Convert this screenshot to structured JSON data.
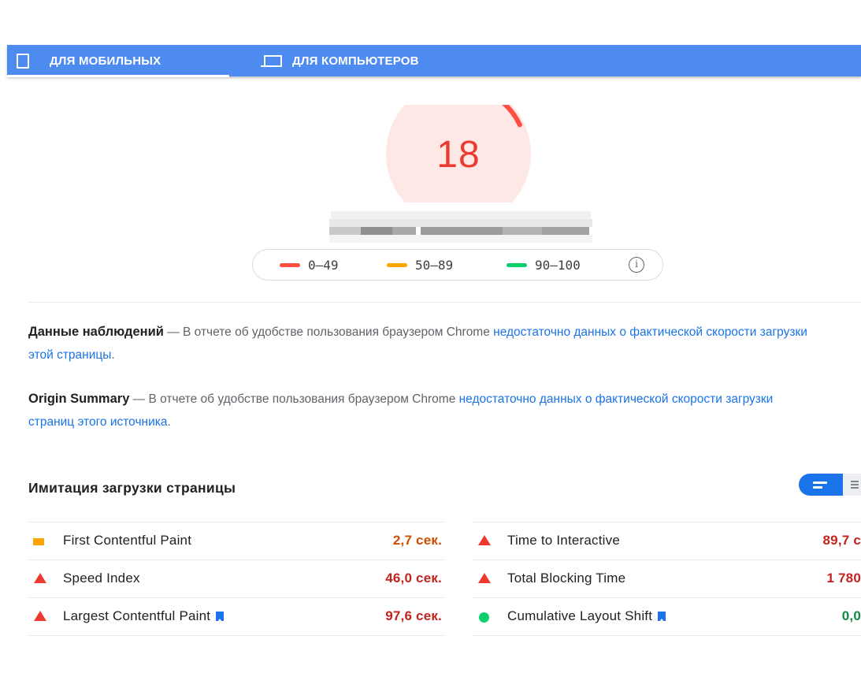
{
  "tabs": {
    "mobile_label": "ДЛЯ МОБИЛЬНЫХ",
    "desktop_label": "ДЛЯ КОМПЬЮТЕРОВ",
    "active": "mobile"
  },
  "score": {
    "value": "18",
    "fraction": 0.18,
    "color": "#eb3b30"
  },
  "legend": {
    "ranges": [
      {
        "label": "0–49",
        "color": "#ff4e42"
      },
      {
        "label": "50–89",
        "color": "#ffa400"
      },
      {
        "label": "90–100",
        "color": "#0cce6b"
      }
    ],
    "info_icon": "info-icon"
  },
  "field_data": {
    "heading": "Данные наблюдений",
    "text": " — В отчете об удобстве пользования браузером Chrome ",
    "link": "недостаточно данных о фактической скорости загрузки этой страницы",
    "end": "."
  },
  "origin_summary": {
    "heading": "Origin Summary",
    "text": " — В отчете об удобстве пользования браузером Chrome ",
    "link": "недостаточно данных о фактической скорости загрузки страниц этого источника",
    "end": "."
  },
  "lab": {
    "title": "Имитация загрузки страницы",
    "view_toggle": {
      "active_icon": "summary-view-icon",
      "inactive_icon": "list-view-icon"
    }
  },
  "metrics": [
    {
      "name": "First Contentful Paint",
      "value": "2,7 сек.",
      "status": "average",
      "info": false
    },
    {
      "name": "Time to Interactive",
      "value": "89,7 с",
      "status": "fail",
      "info": false
    },
    {
      "name": "Speed Index",
      "value": "46,0 сек.",
      "status": "fail",
      "info": false
    },
    {
      "name": "Total Blocking Time",
      "value": "1 780",
      "status": "fail",
      "info": false
    },
    {
      "name": "Largest Contentful Paint",
      "value": "97,6 сек.",
      "status": "fail",
      "info": true
    },
    {
      "name": "Cumulative Layout Shift",
      "value": "0,0",
      "status": "pass",
      "info": true
    }
  ]
}
